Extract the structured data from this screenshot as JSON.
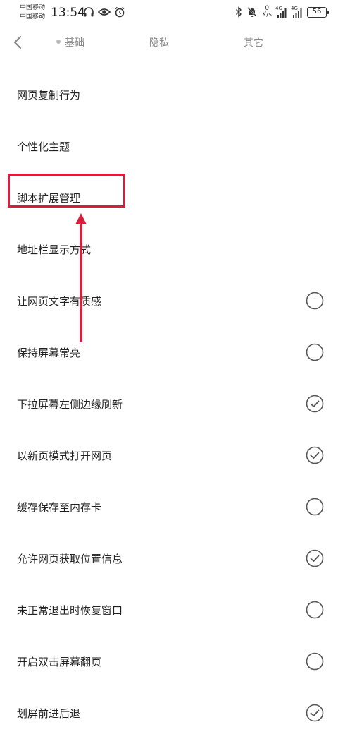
{
  "status_bar": {
    "carrier_1": "中国移动",
    "carrier_2": "中国移动",
    "time": "13:54",
    "net_speed_value": "0",
    "net_speed_unit": "K/s",
    "signal_1_label": "4G",
    "signal_2_label": "4G",
    "battery": "56",
    "icons_left": [
      "headphones-icon",
      "eye-icon",
      "alarm-icon"
    ],
    "icons_right": [
      "bluetooth-icon",
      "mute-bell-icon"
    ]
  },
  "header": {
    "back_icon": "chevron-left-icon",
    "tabs": [
      {
        "label": "基础",
        "active": true
      },
      {
        "label": "隐私",
        "active": false
      },
      {
        "label": "其它",
        "active": false
      }
    ]
  },
  "settings": [
    {
      "label": "网页复制行为",
      "has_toggle": false
    },
    {
      "label": "个性化主题",
      "has_toggle": false
    },
    {
      "label": "脚本扩展管理",
      "has_toggle": false,
      "highlighted": true
    },
    {
      "label": "地址栏显示方式",
      "has_toggle": false
    },
    {
      "label": "让网页文字有质感",
      "has_toggle": true,
      "checked": false
    },
    {
      "label": "保持屏幕常亮",
      "has_toggle": true,
      "checked": false
    },
    {
      "label": "下拉屏幕左侧边缘刷新",
      "has_toggle": true,
      "checked": true
    },
    {
      "label": "以新页模式打开网页",
      "has_toggle": true,
      "checked": true
    },
    {
      "label": "缓存保存至内存卡",
      "has_toggle": true,
      "checked": false
    },
    {
      "label": "允许网页获取位置信息",
      "has_toggle": true,
      "checked": true
    },
    {
      "label": "未正常退出时恢复窗口",
      "has_toggle": true,
      "checked": false
    },
    {
      "label": "开启双击屏幕翻页",
      "has_toggle": true,
      "checked": false
    },
    {
      "label": "划屏前进后退",
      "has_toggle": true,
      "checked": true
    }
  ],
  "colors": {
    "annotation": "#d81e3a",
    "toggle_stroke": "#555555",
    "tab_text": "#888888"
  }
}
